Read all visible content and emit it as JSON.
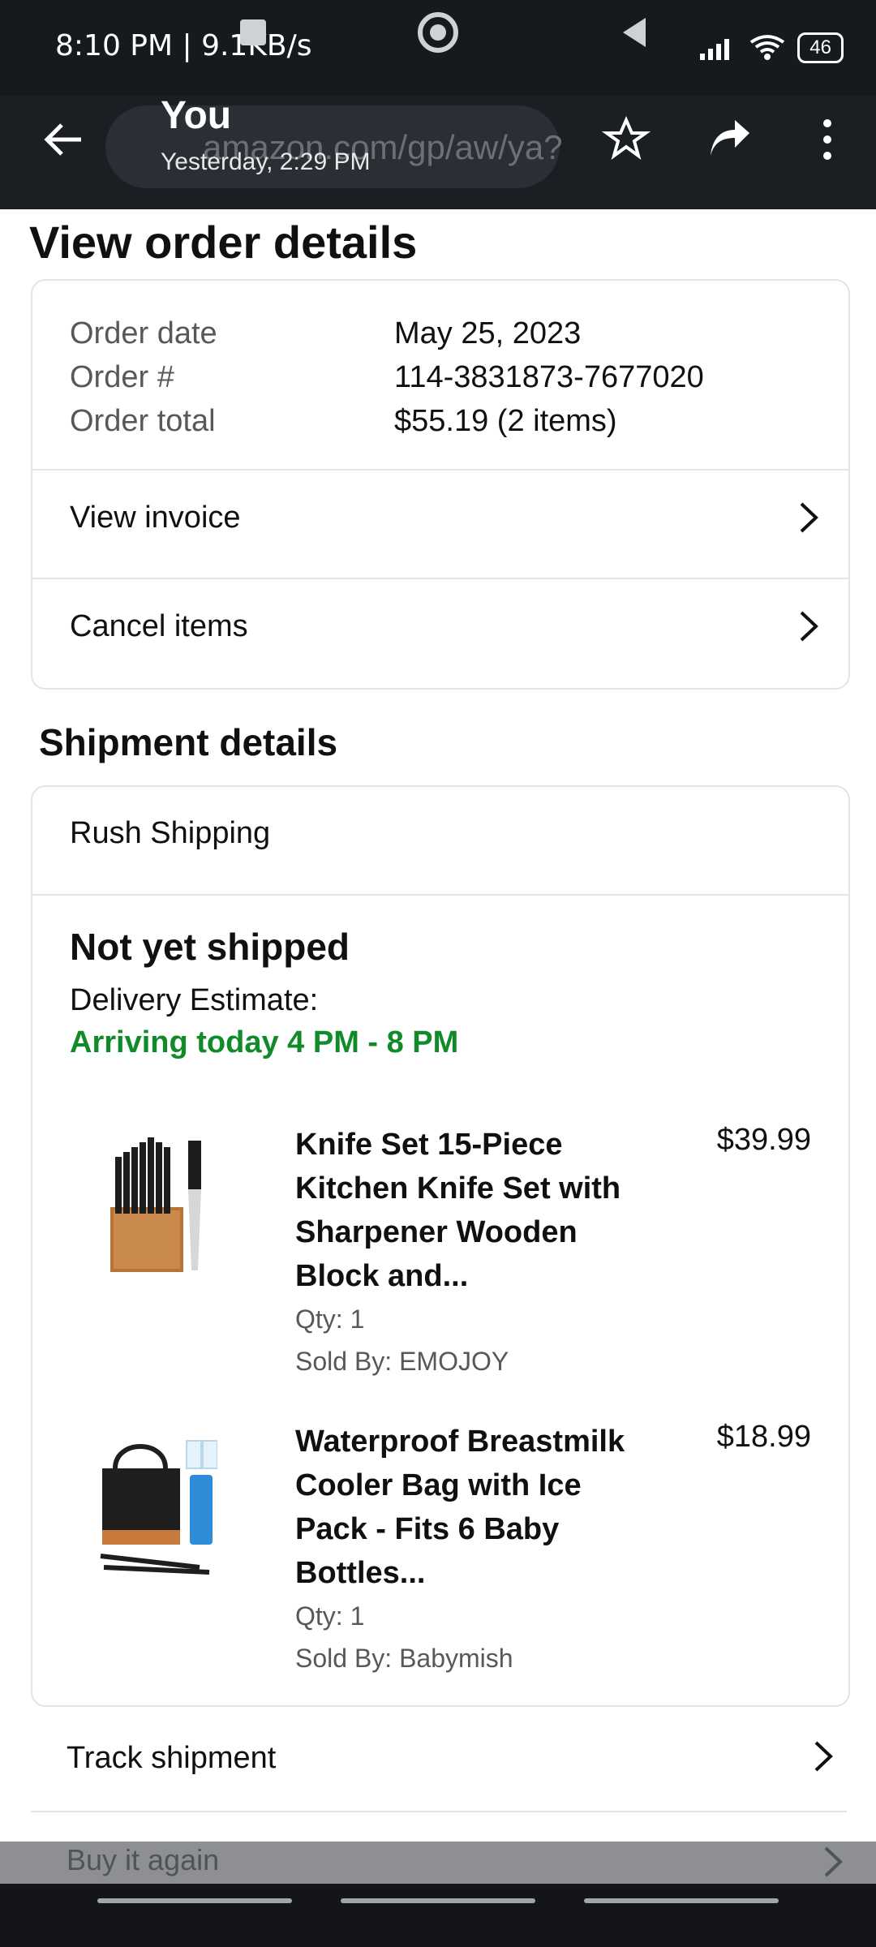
{
  "status_bar": {
    "time_text": "8:10 PM | 9.1KB/s",
    "battery_badge": "46"
  },
  "header": {
    "author": "You",
    "subtitle": "Yesterday, 2:29 PM",
    "ghost_url": "amazon.com/gp/aw/ya?"
  },
  "page": {
    "title": "View order details",
    "order_summary": {
      "rows": [
        {
          "label": "Order date",
          "value": "May 25, 2023"
        },
        {
          "label": "Order #",
          "value": "114-3831873-7677020"
        },
        {
          "label": "Order total",
          "value": "$55.19 (2 items)"
        }
      ],
      "links": [
        {
          "label": "View invoice"
        },
        {
          "label": "Cancel items"
        }
      ]
    },
    "shipment": {
      "title": "Shipment details",
      "shipping_method": "Rush Shipping",
      "status": "Not yet shipped",
      "estimate_label": "Delivery Estimate:",
      "estimate_value": "Arriving today 4 PM - 8 PM",
      "items": [
        {
          "title": "Knife Set 15-Piece Kitchen Knife Set with Sharpener Wooden Block and...",
          "price": "$39.99",
          "qty": "Qty: 1",
          "sold_by": "Sold By: EMOJOY"
        },
        {
          "title": "Waterproof Breastmilk Cooler Bag with Ice Pack - Fits 6 Baby Bottles...",
          "price": "$18.99",
          "qty": "Qty: 1",
          "sold_by": "Sold By: Babymish"
        }
      ],
      "track_label": "Track shipment",
      "buy_again_label": "Buy it again"
    }
  },
  "colors": {
    "brand_green": "#118a2a",
    "header_bg": "#1b1f24"
  }
}
